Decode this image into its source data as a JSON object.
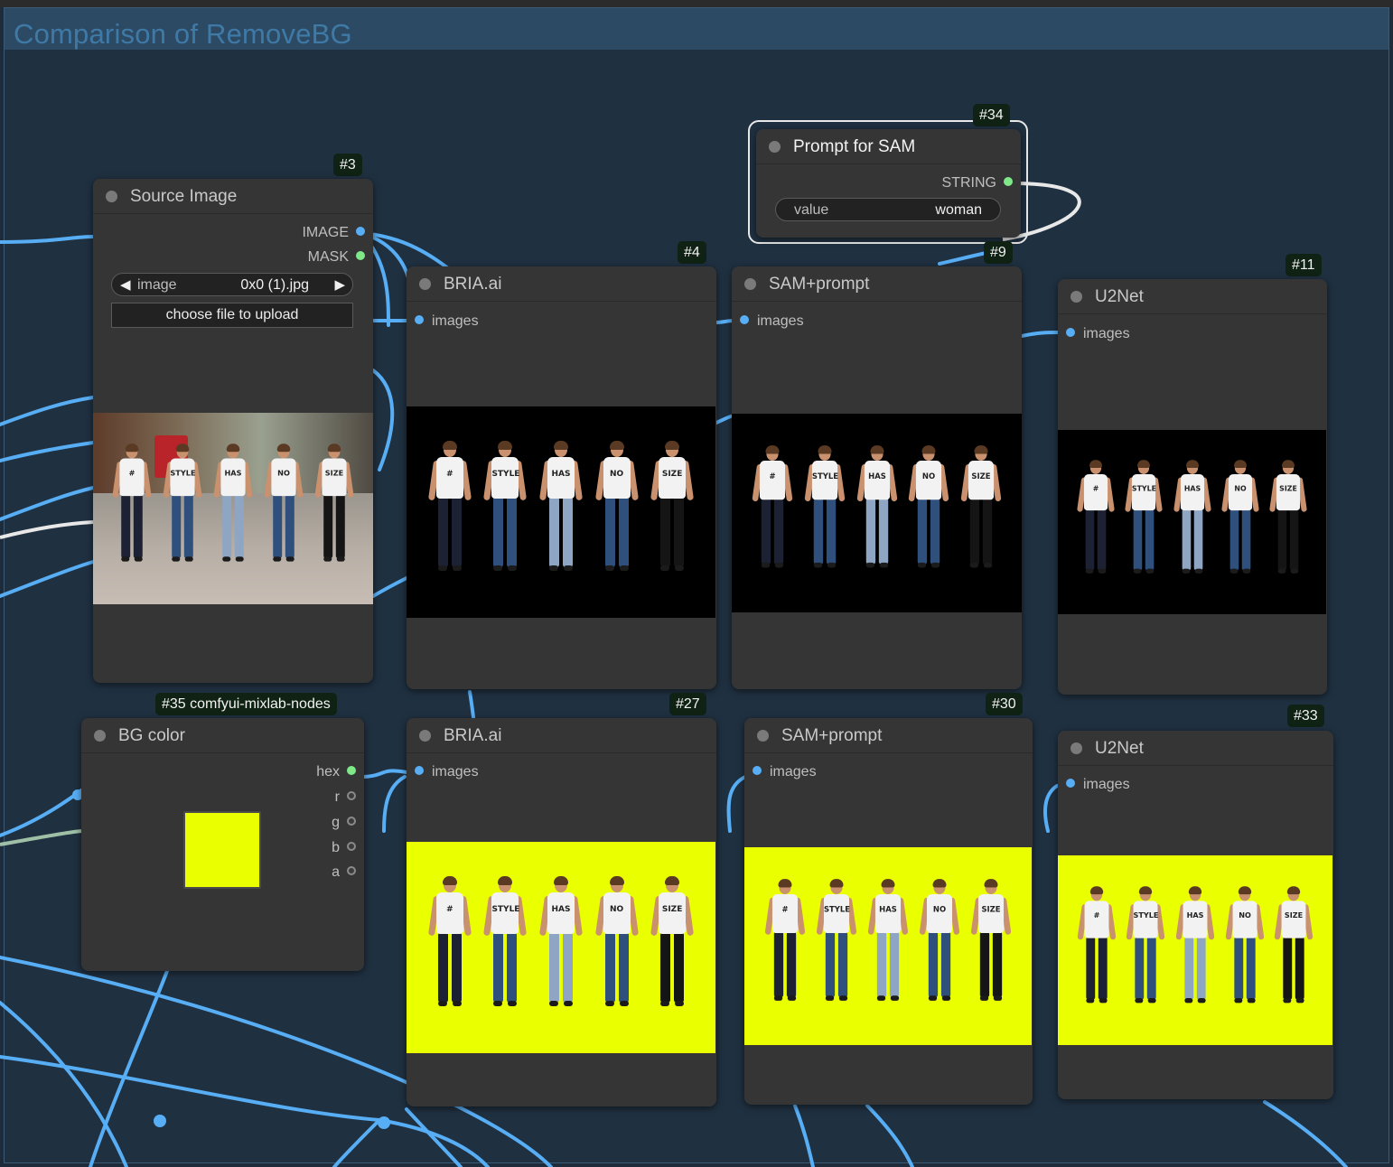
{
  "group": {
    "title": "Comparison of RemoveBG"
  },
  "nodes": {
    "source_image": {
      "badge": "#3",
      "title": "Source Image",
      "outputs": [
        "IMAGE",
        "MASK"
      ],
      "image_widget": {
        "label": "image",
        "value": "0x0 (1).jpg"
      },
      "upload_label": "choose file to upload"
    },
    "prompt_for_sam": {
      "badge": "#34",
      "title": "Prompt for SAM",
      "output": "STRING",
      "widget": {
        "label": "value",
        "value": "woman"
      }
    },
    "bria_top": {
      "badge": "#4",
      "title": "BRIA.ai",
      "input": "images"
    },
    "sam_top": {
      "badge": "#9",
      "title": "SAM+prompt",
      "input": "images"
    },
    "u2net_top": {
      "badge": "#11",
      "title": "U2Net",
      "input": "images"
    },
    "bg_color": {
      "badge": "#35 comfyui-mixlab-nodes",
      "title": "BG color",
      "outputs": [
        "hex",
        "r",
        "g",
        "b",
        "a"
      ],
      "swatch_color": "#EAFF00"
    },
    "bria_bottom": {
      "badge": "#27",
      "title": "BRIA.ai",
      "input": "images"
    },
    "sam_bottom": {
      "badge": "#30",
      "title": "SAM+prompt",
      "input": "images"
    },
    "u2net_bottom": {
      "badge": "#33",
      "title": "U2Net",
      "input": "images"
    }
  },
  "people_shirts": [
    "#",
    "STYLE",
    "HAS",
    "NO",
    "SIZE"
  ],
  "colors": {
    "canvas_bg": "#1d2b3a",
    "wire": "#58aef5",
    "node_bg": "#353535",
    "preview_yellow": "#EAFF00"
  }
}
